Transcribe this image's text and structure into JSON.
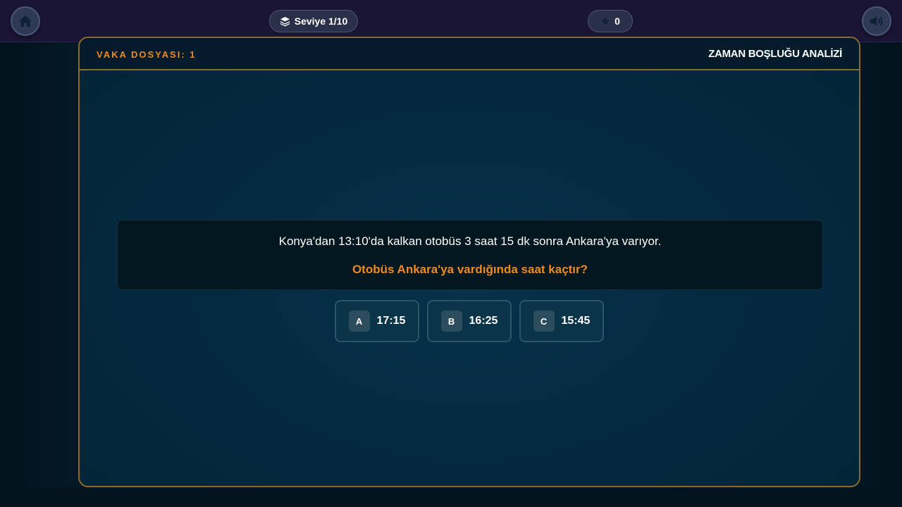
{
  "topbar": {
    "home_icon": "home-icon",
    "level_icon": "layers-icon",
    "level_label": "Seviye 1/10",
    "score_icon": "star-icon",
    "score_value": "0",
    "sound_icon": "volume-icon"
  },
  "panel": {
    "case_label": "VAKA DOSYASI: 1",
    "mode_label": "ZAMAN BOŞLUĞU ANALİZİ"
  },
  "question": {
    "text": "Konya'dan 13:10'da kalkan otobüs 3 saat 15 dk sonra Ankara'ya varıyor.",
    "prompt": "Otobüs Ankara'ya vardığında saat kaçtır?"
  },
  "answers": [
    {
      "key": "A",
      "value": "17:15"
    },
    {
      "key": "B",
      "value": "16:25"
    },
    {
      "key": "C",
      "value": "15:45"
    }
  ],
  "colors": {
    "accent": "#f08a1c",
    "panel_border": "#8a6a2e",
    "topbar_bg": "#1a1535"
  }
}
